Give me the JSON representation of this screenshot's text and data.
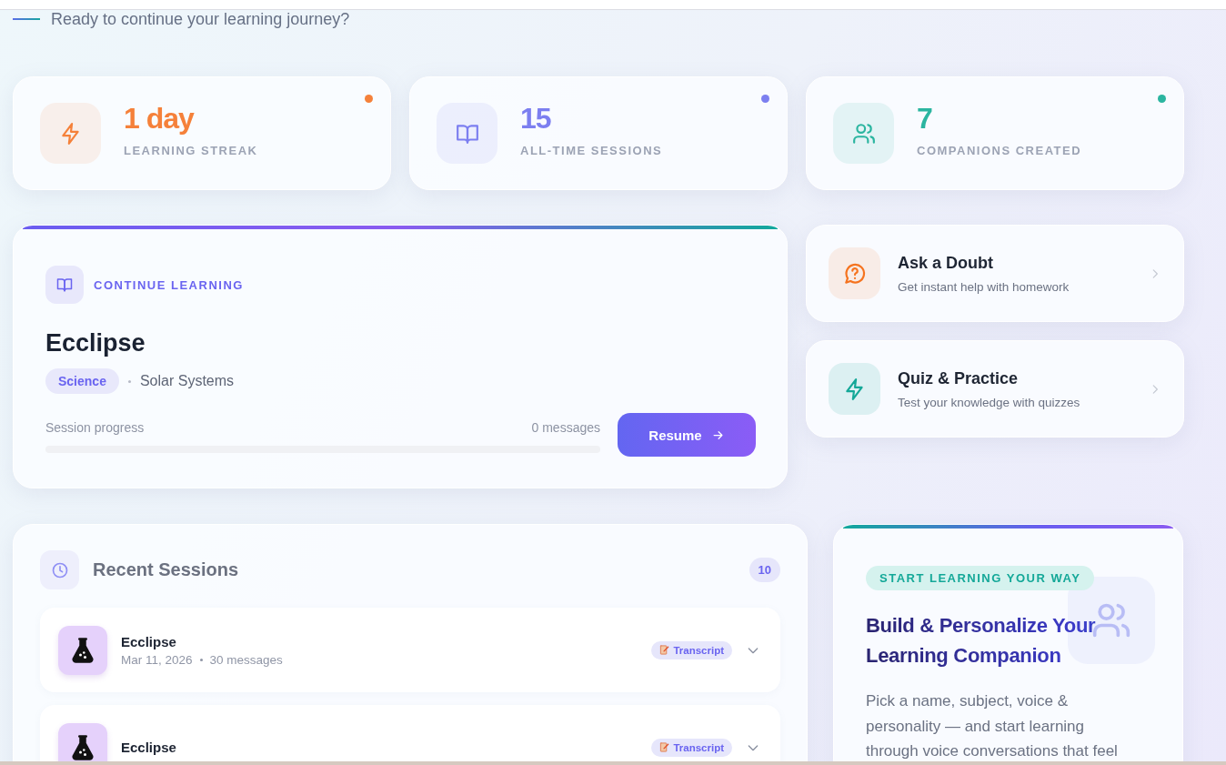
{
  "greeting": "Ready to continue your learning journey?",
  "stats": [
    {
      "kind": "streak",
      "value": "1 day",
      "label": "LEARNING STREAK",
      "color": "#f5813a"
    },
    {
      "kind": "sessions",
      "value": "15",
      "label": "ALL-TIME SESSIONS",
      "color": "#7c7ff0"
    },
    {
      "kind": "companions",
      "value": "7",
      "label": "COMPANIONS CREATED",
      "color": "#2bb5a0"
    }
  ],
  "continue_learning": {
    "eyebrow": "CONTINUE LEARNING",
    "title": "Ecclipse",
    "subject": "Science",
    "topic": "Solar Systems",
    "progress_label": "Session progress",
    "messages": "0 messages",
    "level": 0,
    "button": "Resume"
  },
  "quick_actions": [
    {
      "kind": "doubt",
      "title": "Ask a Doubt",
      "subtitle": "Get instant help with homework"
    },
    {
      "kind": "quiz",
      "title": "Quiz & Practice",
      "subtitle": "Test your knowledge with quizzes"
    }
  ],
  "recent_sessions": {
    "title": "Recent Sessions",
    "count": "10",
    "items": [
      {
        "title": "Ecclipse",
        "date": "Mar 11, 2026",
        "messages": "30 messages",
        "transcript": "Transcript"
      },
      {
        "title": "Ecclipse",
        "transcript": "Transcript"
      }
    ]
  },
  "companion_promo": {
    "tag": "START LEARNING YOUR WAY",
    "title": "Build & Personalize Your Learning Companion",
    "body": "Pick a name, subject, voice & personality — and start learning through voice conversations that feel"
  }
}
